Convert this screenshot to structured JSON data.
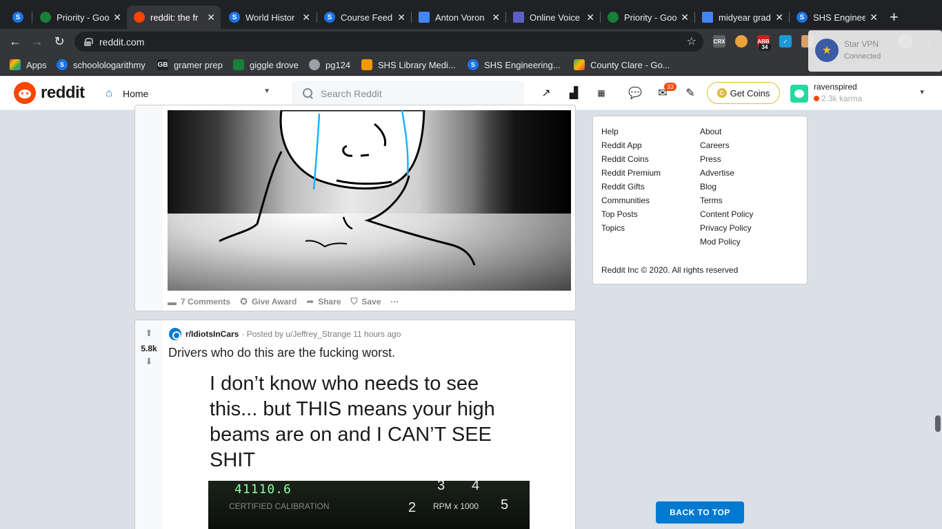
{
  "browser": {
    "tabs": [
      {
        "title": "",
        "icon": "schoology-icon",
        "color": "#1a73e8"
      },
      {
        "title": "Priority - Goo",
        "icon": "google-drive-icon",
        "color": "#188038"
      },
      {
        "title": "reddit: the fr",
        "icon": "reddit-icon",
        "color": "#ff4500",
        "active": true
      },
      {
        "title": "World Histor",
        "icon": "schoology-icon",
        "color": "#1a73e8"
      },
      {
        "title": "Course Feed",
        "icon": "schoology-icon",
        "color": "#1a73e8"
      },
      {
        "title": "Anton Voron",
        "icon": "google-docs-icon",
        "color": "#4285f4"
      },
      {
        "title": "Online Voice",
        "icon": "voice-icon",
        "color": "#5b5fc7"
      },
      {
        "title": "Priority - Goo",
        "icon": "google-drive-icon",
        "color": "#188038"
      },
      {
        "title": "midyear grad",
        "icon": "google-docs-icon",
        "color": "#4285f4"
      },
      {
        "title": "SHS Enginee",
        "icon": "schoology-icon",
        "color": "#1a73e8"
      }
    ],
    "url": "reddit.com",
    "extensions": [
      "CRX",
      "",
      "ABB",
      "",
      "",
      ""
    ],
    "ext_badge": "34",
    "bookmarks": [
      {
        "label": "Apps",
        "icon": "apps-grid-icon"
      },
      {
        "label": "schoolologarithmy",
        "icon": "schoology-icon"
      },
      {
        "label": "gramer prep",
        "icon": "gb-icon"
      },
      {
        "label": "giggle drove",
        "icon": "google-drive-icon"
      },
      {
        "label": "pg124",
        "icon": "globe-icon"
      },
      {
        "label": "SHS Library Medi...",
        "icon": "library-icon"
      },
      {
        "label": "SHS Engineering...",
        "icon": "schoology-icon"
      },
      {
        "label": "County Clare - Go...",
        "icon": "maps-icon"
      }
    ],
    "vpn": {
      "title": "Star VPN",
      "status": "Connected"
    }
  },
  "header": {
    "brand": "reddit",
    "home_label": "Home",
    "search_placeholder": "Search Reddit",
    "mail_badge": "33",
    "coins_label": "Get Coins",
    "username": "ravenspired",
    "karma": "2.3k karma"
  },
  "feed": {
    "post1": {
      "actions": {
        "comments": "7 Comments",
        "award": "Give Award",
        "share": "Share",
        "save": "Save",
        "more": "···"
      }
    },
    "post2": {
      "score": "5.8k",
      "subreddit": "r/IdiotsInCars",
      "meta": "· Posted by u/Jeffrey_Strange 11 hours ago",
      "title": "Drivers who do this are the fucking worst.",
      "image_caption": "I don’t know who needs to see this... but THIS means your high beams are on and I CAN’T SEE SHIT",
      "odometer": "41110.6",
      "cert_text": "CERTIFIED CALIBRATION",
      "rpm_text": "RPM x 1000",
      "gauge_numbers": [
        "2",
        "3",
        "4",
        "5"
      ]
    }
  },
  "sidebar": {
    "col1": [
      "Help",
      "Reddit App",
      "Reddit Coins",
      "Reddit Premium",
      "Reddit Gifts",
      "Communities",
      "Top Posts",
      "Topics"
    ],
    "col2": [
      "About",
      "Careers",
      "Press",
      "Advertise",
      "Blog",
      "Terms",
      "Content Policy",
      "Privacy Policy",
      "Mod Policy"
    ],
    "copyright": "Reddit Inc © 2020. All rights reserved"
  },
  "back_to_top": "BACK TO TOP"
}
